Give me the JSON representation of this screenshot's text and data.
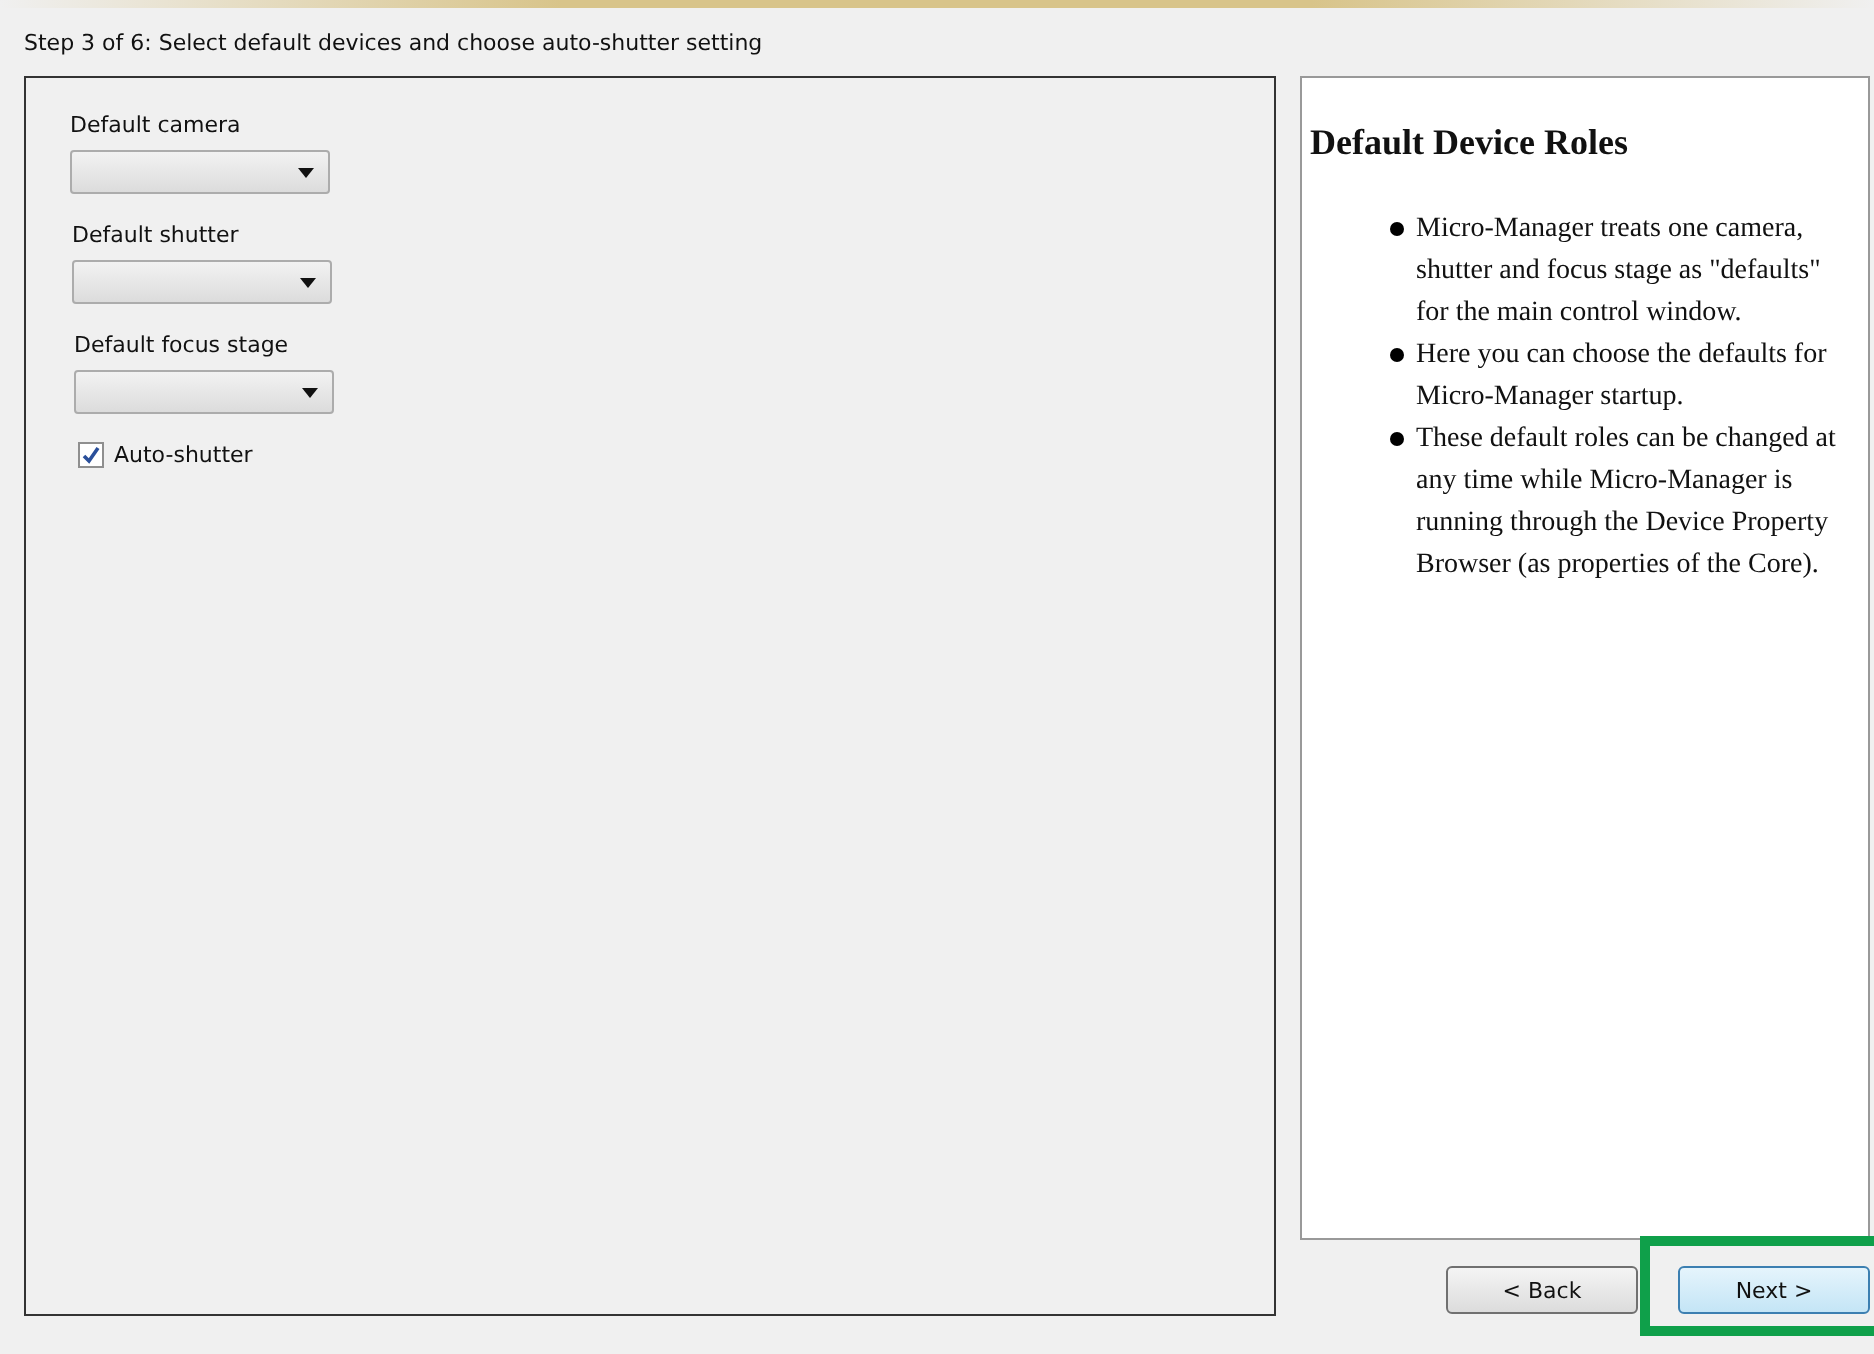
{
  "step_label": "Step 3 of 6: Select default devices and choose auto-shutter setting",
  "dropdowns": [
    {
      "label": "Default camera"
    },
    {
      "label": "Default shutter"
    },
    {
      "label": "Default focus stage"
    }
  ],
  "auto_shutter": {
    "label": "Auto-shutter",
    "checked": true
  },
  "help": {
    "title": "Default Device Roles",
    "items": [
      "Micro-Manager treats one camera, shutter and focus stage as \"defaults\" for the main control window.",
      "Here you can choose the defaults for Micro-Manager startup.",
      "These default roles can be changed at any time while Micro-Manager is running through the Device Property Browser (as properties of the Core)."
    ]
  },
  "buttons": [
    {
      "label": "< Back",
      "focused": false,
      "highlighted": false
    },
    {
      "label": "Next >",
      "focused": true,
      "highlighted": true
    }
  ]
}
